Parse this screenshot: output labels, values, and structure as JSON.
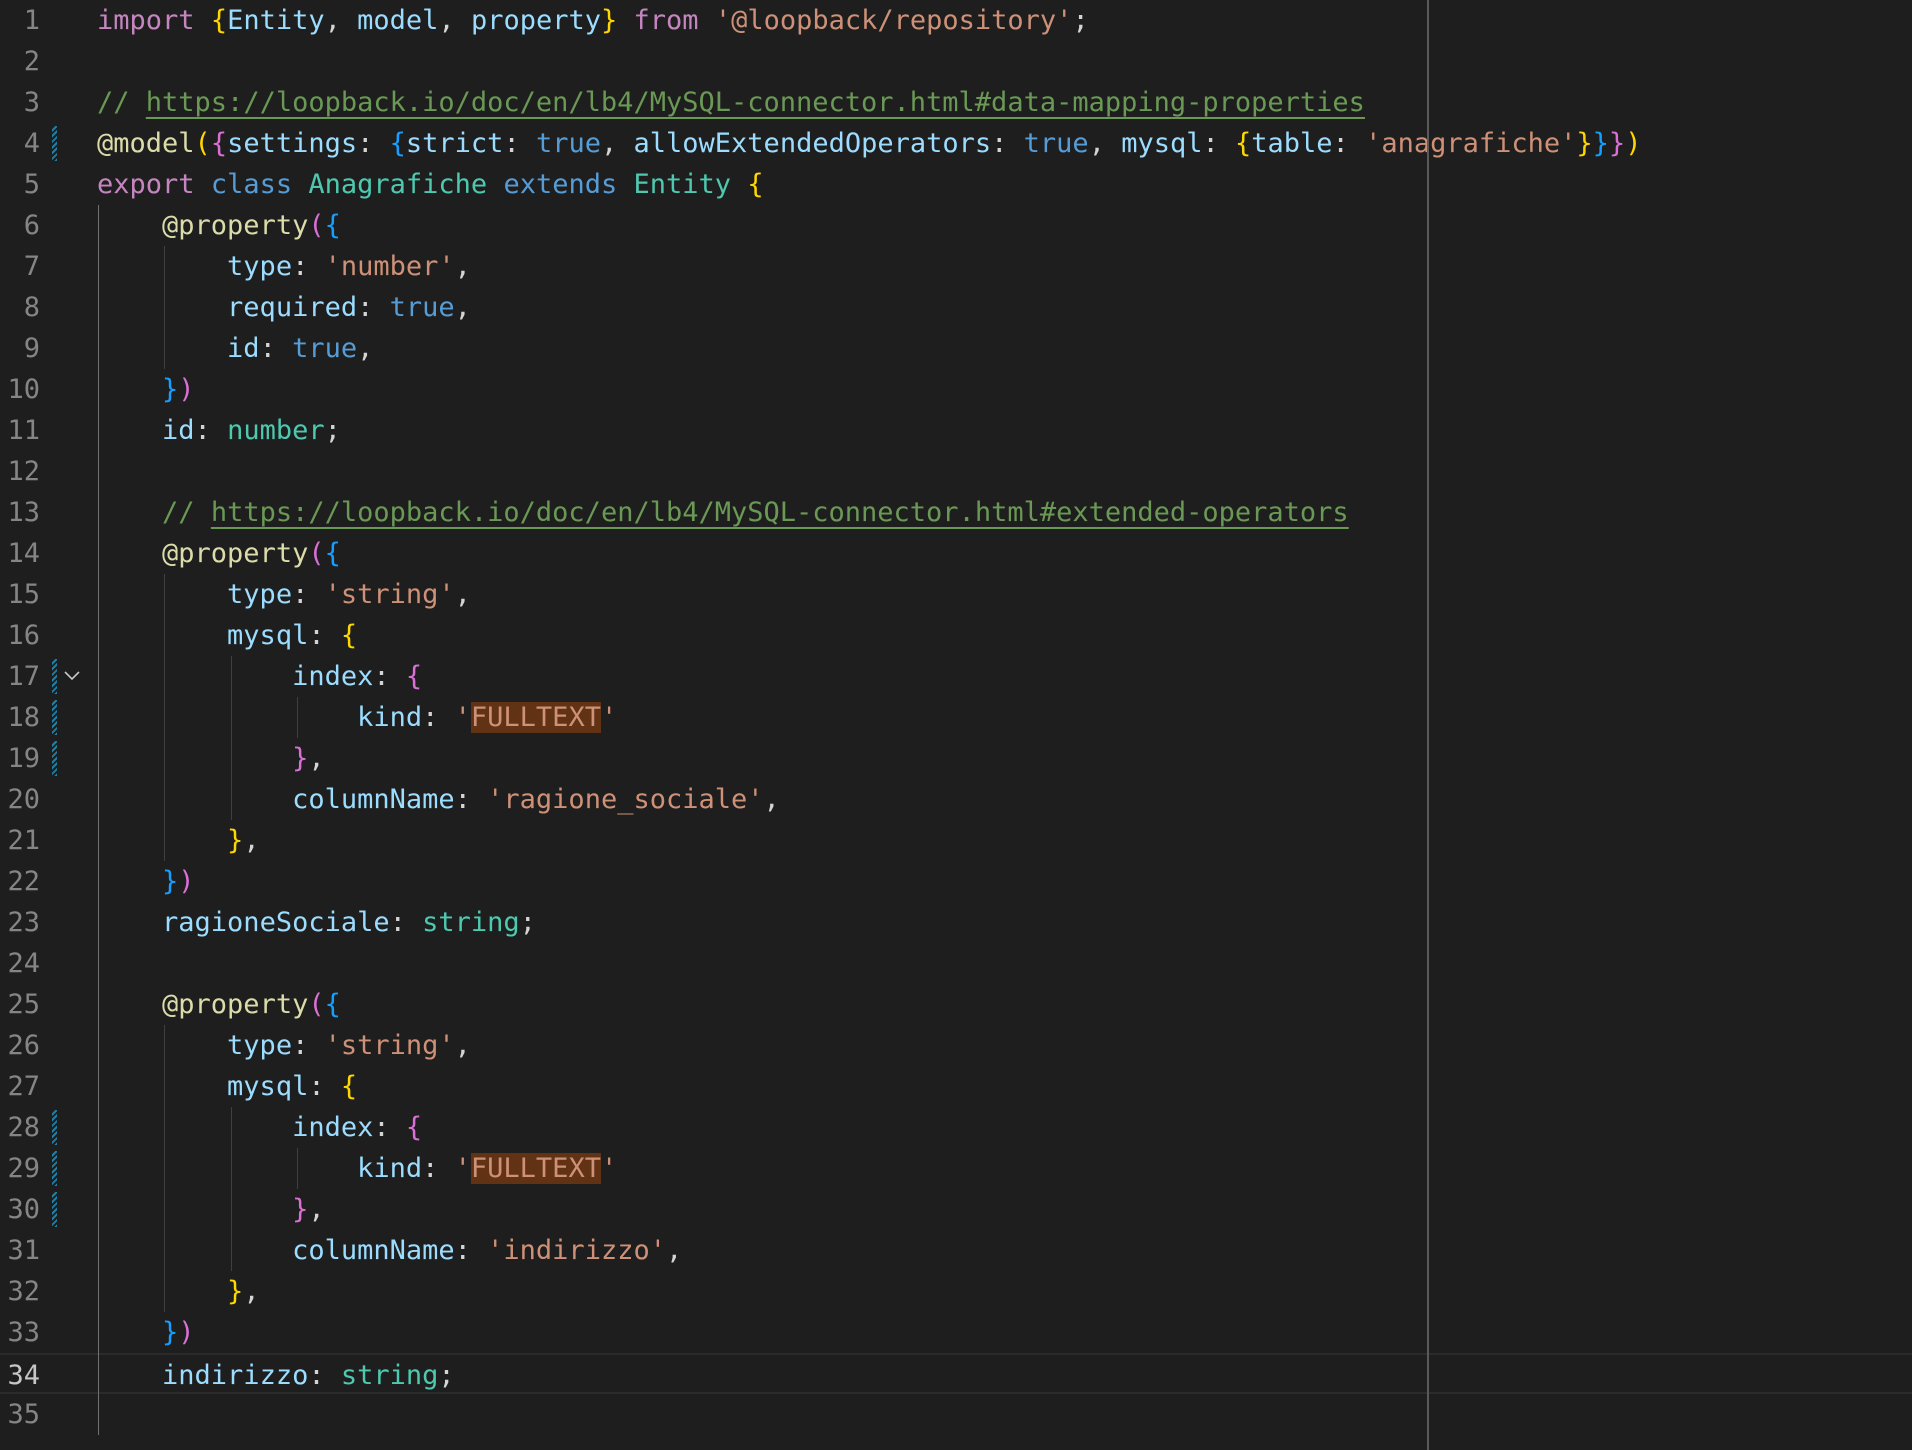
{
  "editor": {
    "language": "typescript",
    "current_line": 34,
    "lines": [
      {
        "n": "1",
        "tokens": [
          [
            "kw",
            "import"
          ],
          [
            "pn",
            " "
          ],
          [
            "b1",
            "{"
          ],
          [
            "vb",
            "Entity"
          ],
          [
            "pn",
            ", "
          ],
          [
            "vb",
            "model"
          ],
          [
            "pn",
            ", "
          ],
          [
            "vb",
            "property"
          ],
          [
            "b1",
            "}"
          ],
          [
            "pn",
            " "
          ],
          [
            "kw",
            "from"
          ],
          [
            "pn",
            " "
          ],
          [
            "str",
            "'@loopback/repository'"
          ],
          [
            "pn",
            ";"
          ]
        ]
      },
      {
        "n": "2",
        "tokens": []
      },
      {
        "n": "3",
        "tokens": [
          [
            "cm",
            "// "
          ],
          [
            "lnk",
            "https://loopback.io/doc/en/lb4/MySQL-connector.html#data-mapping-properties"
          ]
        ]
      },
      {
        "n": "4",
        "tokens": [
          [
            "dc",
            "@model"
          ],
          [
            "b1",
            "("
          ],
          [
            "b2",
            "{"
          ],
          [
            "vb",
            "settings"
          ],
          [
            "pn",
            ": "
          ],
          [
            "b3",
            "{"
          ],
          [
            "vb",
            "strict"
          ],
          [
            "pn",
            ": "
          ],
          [
            "sk",
            "true"
          ],
          [
            "pn",
            ", "
          ],
          [
            "vb",
            "allowExtendedOperators"
          ],
          [
            "pn",
            ": "
          ],
          [
            "sk",
            "true"
          ],
          [
            "pn",
            ", "
          ],
          [
            "vb",
            "mysql"
          ],
          [
            "pn",
            ": "
          ],
          [
            "b1",
            "{"
          ],
          [
            "vb",
            "table"
          ],
          [
            "pn",
            ": "
          ],
          [
            "str",
            "'anagrafiche'"
          ],
          [
            "b1",
            "}"
          ],
          [
            "b3",
            "}"
          ],
          [
            "b2",
            "}"
          ],
          [
            "b1",
            ")"
          ]
        ]
      },
      {
        "n": "5",
        "tokens": [
          [
            "kw",
            "export"
          ],
          [
            "pn",
            " "
          ],
          [
            "sk",
            "class"
          ],
          [
            "pn",
            " "
          ],
          [
            "cl",
            "Anagrafiche"
          ],
          [
            "pn",
            " "
          ],
          [
            "sk",
            "extends"
          ],
          [
            "pn",
            " "
          ],
          [
            "cl",
            "Entity"
          ],
          [
            "pn",
            " "
          ],
          [
            "b1",
            "{"
          ]
        ]
      },
      {
        "n": "6",
        "tokens": [
          [
            "pn",
            "    "
          ],
          [
            "dc",
            "@property"
          ],
          [
            "b2",
            "("
          ],
          [
            "b3",
            "{"
          ]
        ]
      },
      {
        "n": "7",
        "tokens": [
          [
            "pn",
            "        "
          ],
          [
            "vb",
            "type"
          ],
          [
            "pn",
            ": "
          ],
          [
            "str",
            "'number'"
          ],
          [
            "pn",
            ","
          ]
        ]
      },
      {
        "n": "8",
        "tokens": [
          [
            "pn",
            "        "
          ],
          [
            "vb",
            "required"
          ],
          [
            "pn",
            ": "
          ],
          [
            "sk",
            "true"
          ],
          [
            "pn",
            ","
          ]
        ]
      },
      {
        "n": "9",
        "tokens": [
          [
            "pn",
            "        "
          ],
          [
            "vb",
            "id"
          ],
          [
            "pn",
            ": "
          ],
          [
            "sk",
            "true"
          ],
          [
            "pn",
            ","
          ]
        ]
      },
      {
        "n": "10",
        "tokens": [
          [
            "pn",
            "    "
          ],
          [
            "b3",
            "}"
          ],
          [
            "b2",
            ")"
          ]
        ]
      },
      {
        "n": "11",
        "tokens": [
          [
            "pn",
            "    "
          ],
          [
            "vb",
            "id"
          ],
          [
            "pn",
            ": "
          ],
          [
            "ty",
            "number"
          ],
          [
            "pn",
            ";"
          ]
        ]
      },
      {
        "n": "12",
        "tokens": []
      },
      {
        "n": "13",
        "tokens": [
          [
            "pn",
            "    "
          ],
          [
            "cm",
            "// "
          ],
          [
            "lnk",
            "https://loopback.io/doc/en/lb4/MySQL-connector.html#extended-operators"
          ]
        ]
      },
      {
        "n": "14",
        "tokens": [
          [
            "pn",
            "    "
          ],
          [
            "dc",
            "@property"
          ],
          [
            "b2",
            "("
          ],
          [
            "b3",
            "{"
          ]
        ]
      },
      {
        "n": "15",
        "tokens": [
          [
            "pn",
            "        "
          ],
          [
            "vb",
            "type"
          ],
          [
            "pn",
            ": "
          ],
          [
            "str",
            "'string'"
          ],
          [
            "pn",
            ","
          ]
        ]
      },
      {
        "n": "16",
        "tokens": [
          [
            "pn",
            "        "
          ],
          [
            "vb",
            "mysql"
          ],
          [
            "pn",
            ": "
          ],
          [
            "b1",
            "{"
          ]
        ]
      },
      {
        "n": "17",
        "tokens": [
          [
            "pn",
            "            "
          ],
          [
            "vb",
            "index"
          ],
          [
            "pn",
            ": "
          ],
          [
            "b2",
            "{"
          ]
        ]
      },
      {
        "n": "18",
        "tokens": [
          [
            "pn",
            "                "
          ],
          [
            "vb",
            "kind"
          ],
          [
            "pn",
            ": "
          ],
          [
            "str",
            "'"
          ],
          [
            "str hl",
            "FULLTEXT"
          ],
          [
            "str",
            "'"
          ]
        ]
      },
      {
        "n": "19",
        "tokens": [
          [
            "pn",
            "            "
          ],
          [
            "b2",
            "}"
          ],
          [
            "pn",
            ","
          ]
        ]
      },
      {
        "n": "20",
        "tokens": [
          [
            "pn",
            "            "
          ],
          [
            "vb",
            "columnName"
          ],
          [
            "pn",
            ": "
          ],
          [
            "str",
            "'ragione_sociale'"
          ],
          [
            "pn",
            ","
          ]
        ]
      },
      {
        "n": "21",
        "tokens": [
          [
            "pn",
            "        "
          ],
          [
            "b1",
            "}"
          ],
          [
            "pn",
            ","
          ]
        ]
      },
      {
        "n": "22",
        "tokens": [
          [
            "pn",
            "    "
          ],
          [
            "b3",
            "}"
          ],
          [
            "b2",
            ")"
          ]
        ]
      },
      {
        "n": "23",
        "tokens": [
          [
            "pn",
            "    "
          ],
          [
            "vb",
            "ragioneSociale"
          ],
          [
            "pn",
            ": "
          ],
          [
            "ty",
            "string"
          ],
          [
            "pn",
            ";"
          ]
        ]
      },
      {
        "n": "24",
        "tokens": []
      },
      {
        "n": "25",
        "tokens": [
          [
            "pn",
            "    "
          ],
          [
            "dc",
            "@property"
          ],
          [
            "b2",
            "("
          ],
          [
            "b3",
            "{"
          ]
        ]
      },
      {
        "n": "26",
        "tokens": [
          [
            "pn",
            "        "
          ],
          [
            "vb",
            "type"
          ],
          [
            "pn",
            ": "
          ],
          [
            "str",
            "'string'"
          ],
          [
            "pn",
            ","
          ]
        ]
      },
      {
        "n": "27",
        "tokens": [
          [
            "pn",
            "        "
          ],
          [
            "vb",
            "mysql"
          ],
          [
            "pn",
            ": "
          ],
          [
            "b1",
            "{"
          ]
        ]
      },
      {
        "n": "28",
        "tokens": [
          [
            "pn",
            "            "
          ],
          [
            "vb",
            "index"
          ],
          [
            "pn",
            ": "
          ],
          [
            "b2",
            "{"
          ]
        ]
      },
      {
        "n": "29",
        "tokens": [
          [
            "pn",
            "                "
          ],
          [
            "vb",
            "kind"
          ],
          [
            "pn",
            ": "
          ],
          [
            "str",
            "'"
          ],
          [
            "str hl",
            "FULLTEXT"
          ],
          [
            "str",
            "'"
          ]
        ]
      },
      {
        "n": "30",
        "tokens": [
          [
            "pn",
            "            "
          ],
          [
            "b2",
            "}"
          ],
          [
            "pn",
            ","
          ]
        ]
      },
      {
        "n": "31",
        "tokens": [
          [
            "pn",
            "            "
          ],
          [
            "vb",
            "columnName"
          ],
          [
            "pn",
            ": "
          ],
          [
            "str",
            "'indirizzo'"
          ],
          [
            "pn",
            ","
          ]
        ]
      },
      {
        "n": "32",
        "tokens": [
          [
            "pn",
            "        "
          ],
          [
            "b1",
            "}"
          ],
          [
            "pn",
            ","
          ]
        ]
      },
      {
        "n": "33",
        "tokens": [
          [
            "pn",
            "    "
          ],
          [
            "b3",
            "}"
          ],
          [
            "b2",
            ")"
          ]
        ]
      },
      {
        "n": "34",
        "tokens": [
          [
            "pn",
            "    "
          ],
          [
            "vb",
            "indirizzo"
          ],
          [
            "pn",
            ": "
          ],
          [
            "ty",
            "string"
          ],
          [
            "pn",
            ";"
          ]
        ]
      },
      {
        "n": "35",
        "tokens": []
      }
    ]
  }
}
